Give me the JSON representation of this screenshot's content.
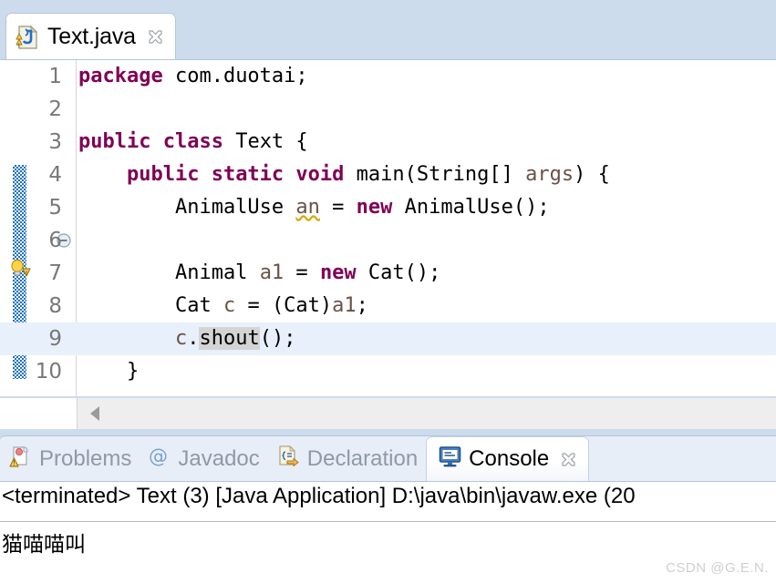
{
  "editor": {
    "tab": {
      "title": "Text.java",
      "icon": "java-file-icon",
      "close_icon": "close-icon"
    },
    "gutter": {
      "quickfix_icon": "lightbulb-warning-icon",
      "fold_icon": "fold-collapse-icon",
      "change_bar": "changed-lines-bar"
    },
    "lines": [
      {
        "number": "1",
        "current": false,
        "tokens": [
          {
            "text": "package",
            "cls": "kw"
          },
          {
            "text": " com.duotai;",
            "cls": "typ"
          }
        ]
      },
      {
        "number": "2",
        "current": false,
        "tokens": []
      },
      {
        "number": "3",
        "current": false,
        "tokens": [
          {
            "text": "public class",
            "cls": "kw"
          },
          {
            "text": " Text {",
            "cls": "typ"
          }
        ]
      },
      {
        "number": "4",
        "current": false,
        "tokens": [
          {
            "text": "    ",
            "cls": "typ"
          },
          {
            "text": "public static void",
            "cls": "kw"
          },
          {
            "text": " main(String[] ",
            "cls": "typ"
          },
          {
            "text": "args",
            "cls": "var"
          },
          {
            "text": ") {",
            "cls": "typ"
          }
        ]
      },
      {
        "number": "5",
        "current": false,
        "tokens": [
          {
            "text": "        AnimalUse ",
            "cls": "typ"
          },
          {
            "text": "an",
            "cls": "unused"
          },
          {
            "text": " = ",
            "cls": "typ"
          },
          {
            "text": "new",
            "cls": "kw"
          },
          {
            "text": " AnimalUse();",
            "cls": "typ"
          }
        ]
      },
      {
        "number": "6",
        "current": false,
        "tokens": []
      },
      {
        "number": "7",
        "current": false,
        "tokens": [
          {
            "text": "        Animal ",
            "cls": "typ"
          },
          {
            "text": "a1",
            "cls": "var"
          },
          {
            "text": " = ",
            "cls": "typ"
          },
          {
            "text": "new",
            "cls": "kw"
          },
          {
            "text": " Cat();",
            "cls": "typ"
          }
        ]
      },
      {
        "number": "8",
        "current": false,
        "tokens": [
          {
            "text": "        Cat ",
            "cls": "typ"
          },
          {
            "text": "c",
            "cls": "var"
          },
          {
            "text": " = (Cat)",
            "cls": "typ"
          },
          {
            "text": "a1",
            "cls": "var"
          },
          {
            "text": ";",
            "cls": "typ"
          }
        ]
      },
      {
        "number": "9",
        "current": true,
        "tokens": [
          {
            "text": "        ",
            "cls": "typ"
          },
          {
            "text": "c",
            "cls": "var"
          },
          {
            "text": ".",
            "cls": "typ"
          },
          {
            "text": "shout",
            "cls": "occ"
          },
          {
            "text": "();",
            "cls": "typ"
          }
        ]
      },
      {
        "number": "10",
        "current": false,
        "tokens": [
          {
            "text": "    }",
            "cls": "typ"
          }
        ]
      }
    ],
    "hscroll": {
      "left_arrow_icon": "scroll-left-arrow-icon"
    }
  },
  "console_view": {
    "tabs": [
      {
        "label": "Problems",
        "icon": "problems-icon",
        "active": false
      },
      {
        "label": "Javadoc",
        "icon": "at-sign-icon",
        "active": false
      },
      {
        "label": "Declaration",
        "icon": "declaration-icon",
        "active": false
      },
      {
        "label": "Console",
        "icon": "console-monitor-icon",
        "active": true
      }
    ],
    "close_icon": "close-icon",
    "output": {
      "header": "<terminated> Text (3) [Java Application] D:\\java\\bin\\javaw.exe (20",
      "body": "猫喵喵叫"
    }
  },
  "watermark": "CSDN @G.E.N.",
  "colors": {
    "keyword": "#7F0055",
    "tabbar_bg": "#CCDCEC",
    "current_line": "#E8F0FB",
    "occurrence": "#D4D4D4",
    "changebar": "#1A6FC4",
    "inactive_tab_text": "#8E9AA6"
  }
}
